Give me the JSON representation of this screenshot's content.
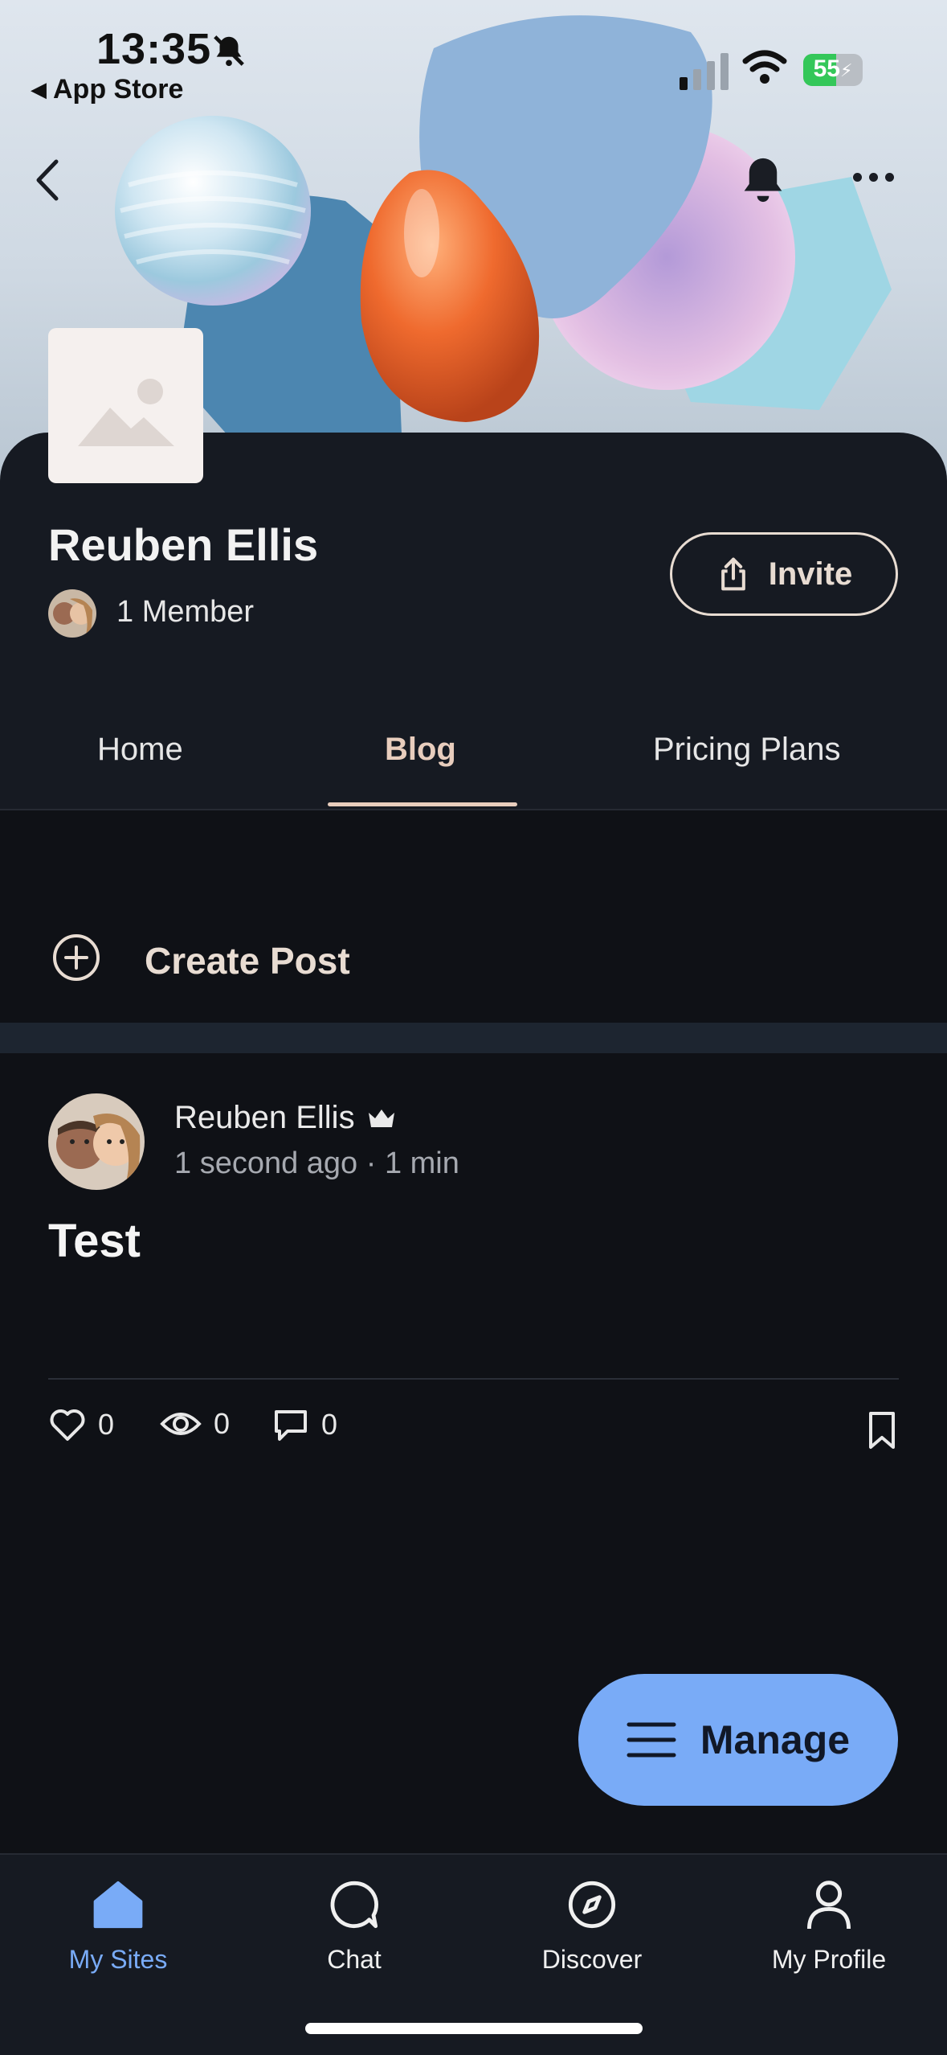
{
  "status_bar": {
    "time": "13:35",
    "back_label": "App Store",
    "battery_percent": "55",
    "battery_level": 0.55,
    "signal_bars_active": 1,
    "icons": [
      "bell-slash-icon",
      "signal-icon",
      "wifi-icon",
      "battery-charging-icon"
    ]
  },
  "header": {
    "icons": [
      "chevron-left-icon",
      "bell-icon",
      "more-icon"
    ]
  },
  "site": {
    "name": "Reuben Ellis",
    "member_count": "1 Member",
    "invite_label": "Invite"
  },
  "tabs": [
    {
      "label": "Home",
      "active": false
    },
    {
      "label": "Blog",
      "active": true
    },
    {
      "label": "Pricing Plans",
      "active": false
    }
  ],
  "create_post": {
    "label": "Create Post"
  },
  "post": {
    "author": "Reuben Ellis",
    "meta": "1 second ago · 1 min",
    "title": "Test",
    "likes": "0",
    "views": "0",
    "comments": "0"
  },
  "manage_button": {
    "label": "Manage"
  },
  "bottom_nav": [
    {
      "label": "My Sites",
      "icon": "home-icon",
      "active": true
    },
    {
      "label": "Chat",
      "icon": "chat-icon",
      "active": false
    },
    {
      "label": "Discover",
      "icon": "compass-icon",
      "active": false
    },
    {
      "label": "My Profile",
      "icon": "user-icon",
      "active": false
    }
  ],
  "colors": {
    "accent": "#79abf7",
    "tab_active": "#e8cdbd",
    "background": "#0f1116",
    "panel": "#161a22"
  }
}
